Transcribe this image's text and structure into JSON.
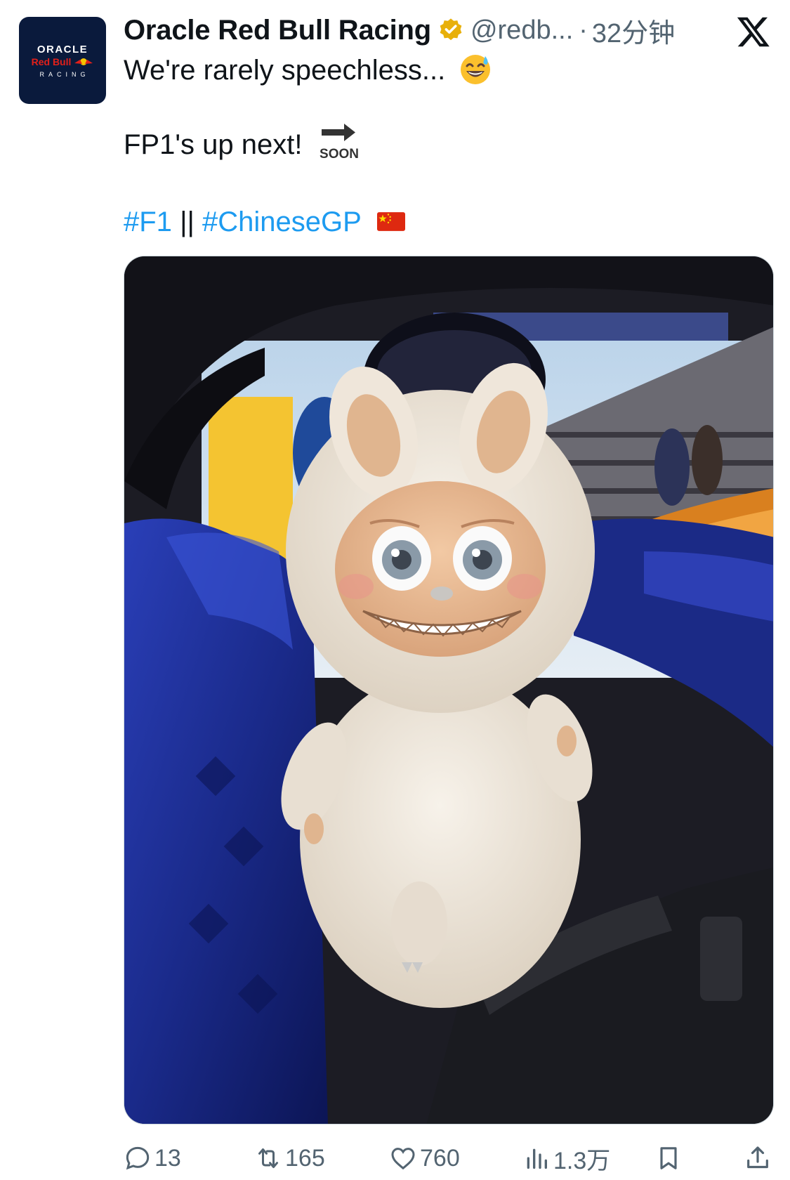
{
  "account": {
    "name": "Oracle Red Bull Racing",
    "handle": "@redb...",
    "separator": "·",
    "time": "32分钟",
    "avatar_logo": {
      "line1": "ORACLE",
      "line2": "Red Bull",
      "line3": "RACING"
    }
  },
  "tweet": {
    "line1": "We're rarely speechless...",
    "line2": "FP1's up next!",
    "soon_label": "SOON",
    "hashtag1": "#F1",
    "divider": "||",
    "hashtag2": "#ChineseGP"
  },
  "stats": {
    "replies": "13",
    "retweets": "165",
    "likes": "760",
    "views": "1.3万"
  },
  "colors": {
    "link": "#1d9bf0",
    "muted": "#536471",
    "verified": "#e8b00a",
    "avatar_bg": "#0a1a3c"
  },
  "icons": [
    "verified-badge-icon",
    "x-logo-icon",
    "sweat-smile-emoji",
    "soon-arrow-emoji",
    "china-flag-emoji",
    "reply-icon",
    "retweet-icon",
    "like-icon",
    "views-icon",
    "bookmark-icon",
    "share-icon"
  ]
}
